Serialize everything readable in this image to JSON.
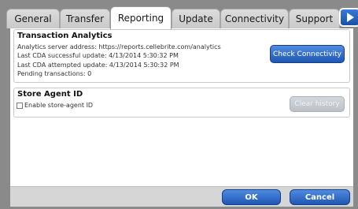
{
  "tabs": [
    {
      "label": "General"
    },
    {
      "label": "Transfer"
    },
    {
      "label": "Reporting"
    },
    {
      "label": "Update"
    },
    {
      "label": "Connectivity"
    },
    {
      "label": "Support"
    }
  ],
  "active_tab": "Reporting",
  "transaction_analytics": {
    "title": "Transaction Analytics",
    "server_address": "Analytics server address: https://reports.cellebrite.com/analytics",
    "last_success": "Last CDA successful update: 4/13/2014 5:30:32 PM",
    "last_attempt": "Last CDA attempted update: 4/13/2014 5:30:32 PM",
    "pending": "Pending transactions: 0",
    "check_button": "Check Connectivity"
  },
  "store_agent": {
    "title": "Store Agent ID",
    "checkbox_label": "Enable store-agent ID",
    "checkbox_checked": false,
    "clear_button": "Clear history"
  },
  "footer": {
    "ok_label": "OK",
    "cancel_label": "Cancel"
  }
}
